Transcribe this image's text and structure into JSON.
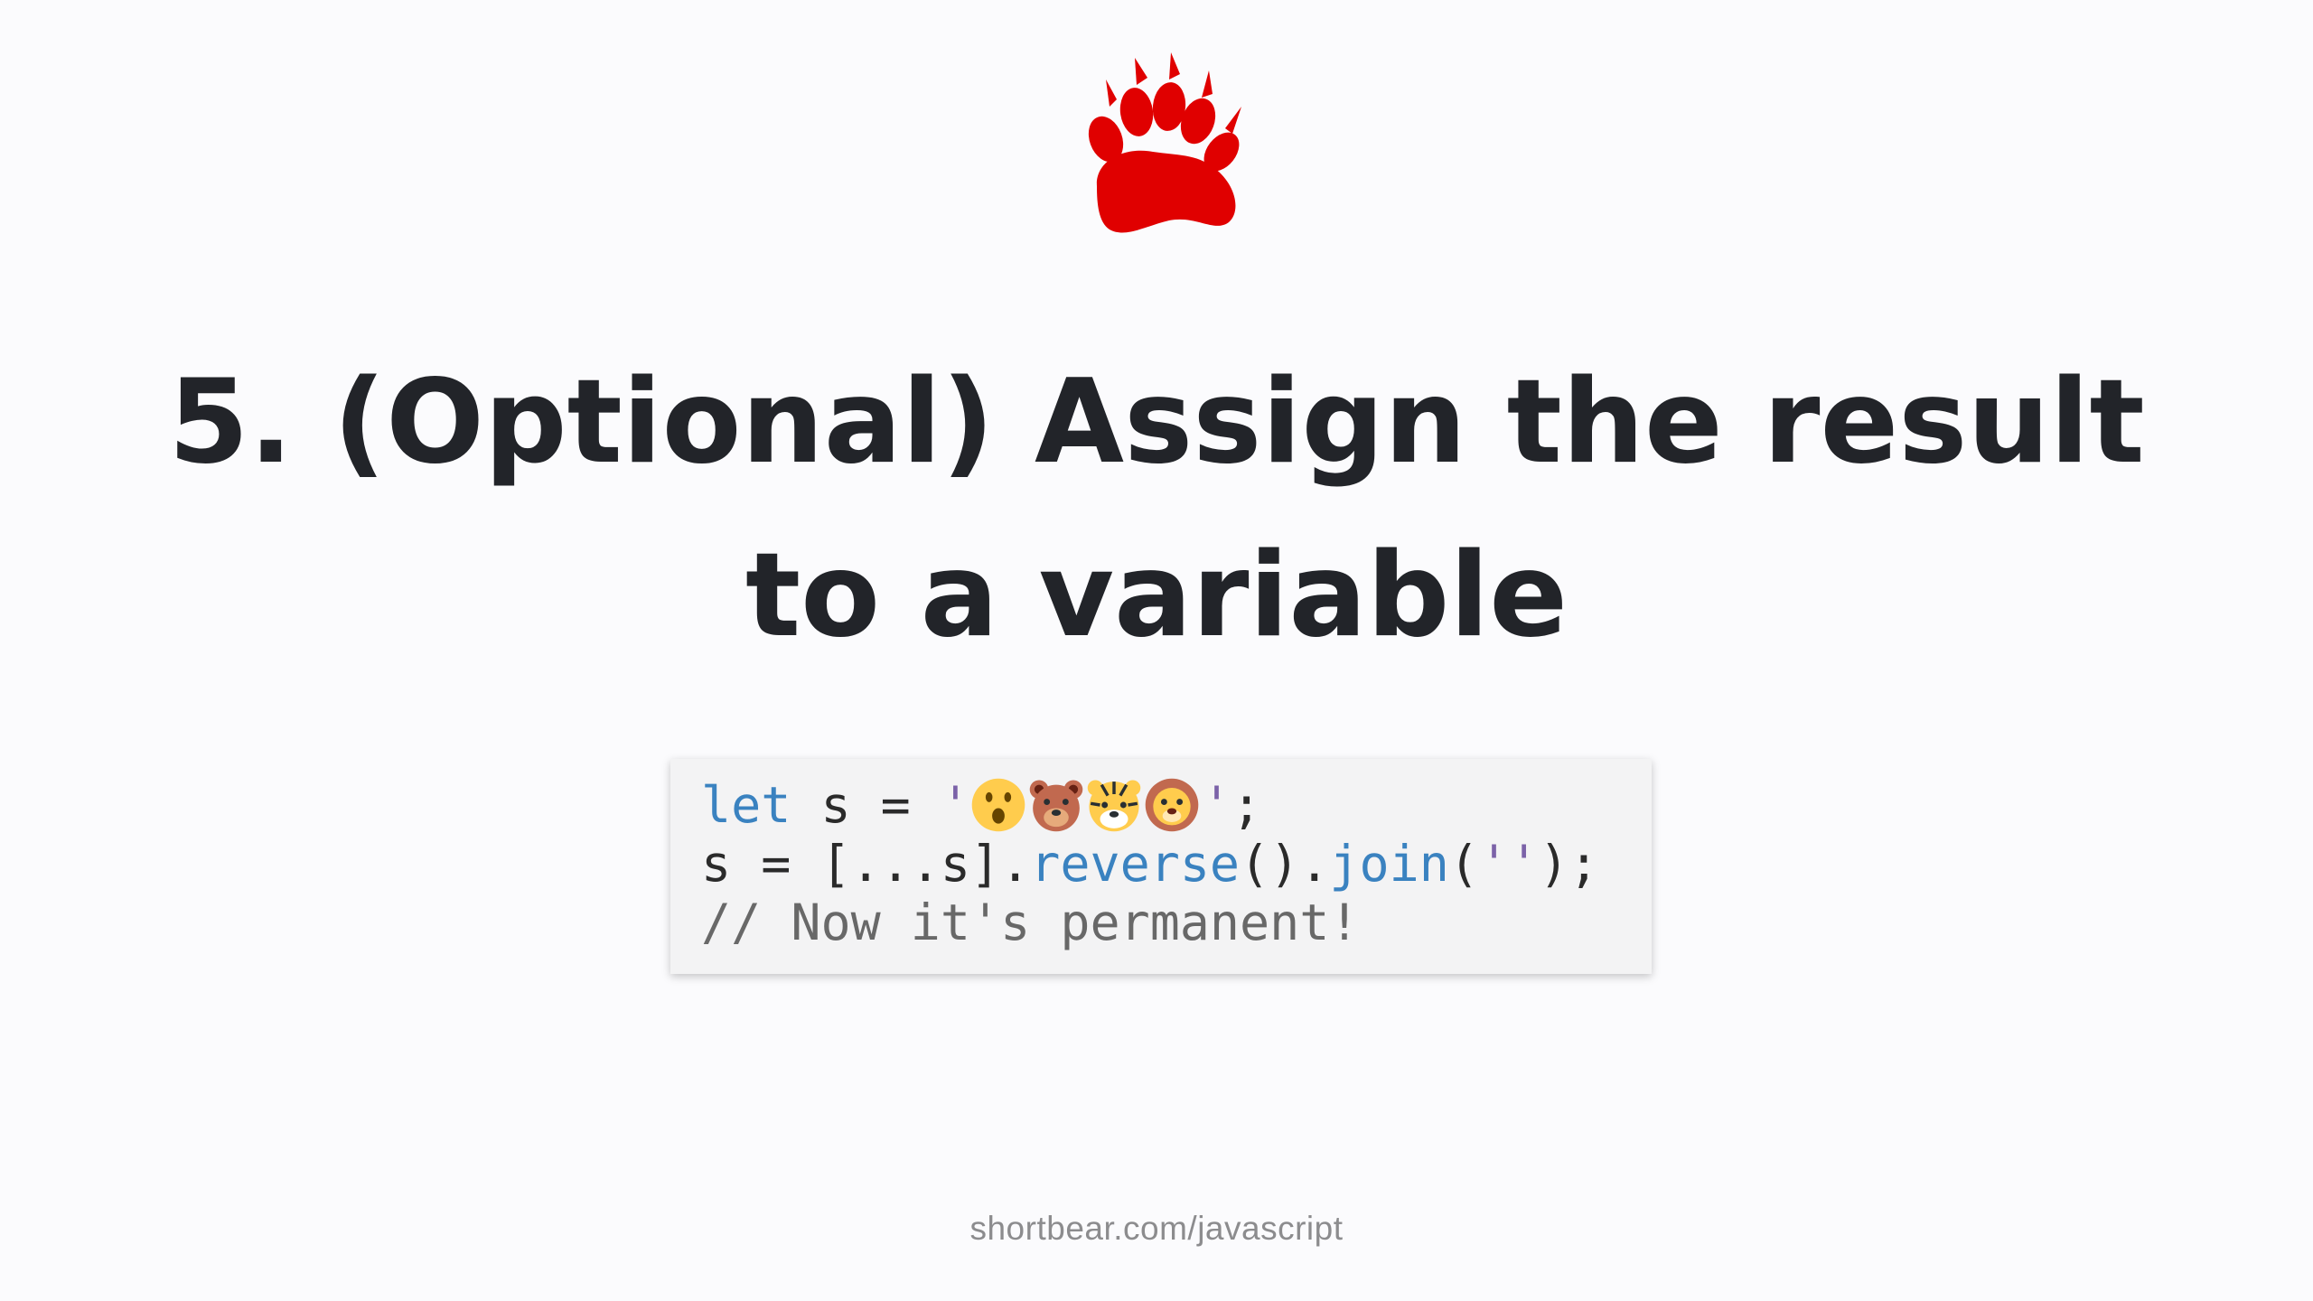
{
  "logo": {
    "icon": "bear-paw-icon",
    "color": "#e00000"
  },
  "title": "5. (Optional) Assign the result to a variable",
  "code": {
    "line1": {
      "kw": "let",
      "mid": " s = ",
      "quote_open": "'",
      "emojis": [
        "face-with-open-mouth-emoji",
        "bear-face-emoji",
        "tiger-face-emoji",
        "lion-face-emoji"
      ],
      "quote_close": "'",
      "end": ";"
    },
    "line2": {
      "a": "s = [...s].",
      "fn1": "reverse",
      "b": "().",
      "fn2": "join",
      "c": "(",
      "str": "''",
      "d": ");"
    },
    "line3": {
      "comment": "// Now it's permanent!"
    },
    "colors": {
      "keyword": "#3a82c0",
      "string": "#7b62a8",
      "comment": "#686868",
      "background": "#f3f3f4"
    }
  },
  "footer": {
    "text": "shortbear.com/javascript"
  }
}
